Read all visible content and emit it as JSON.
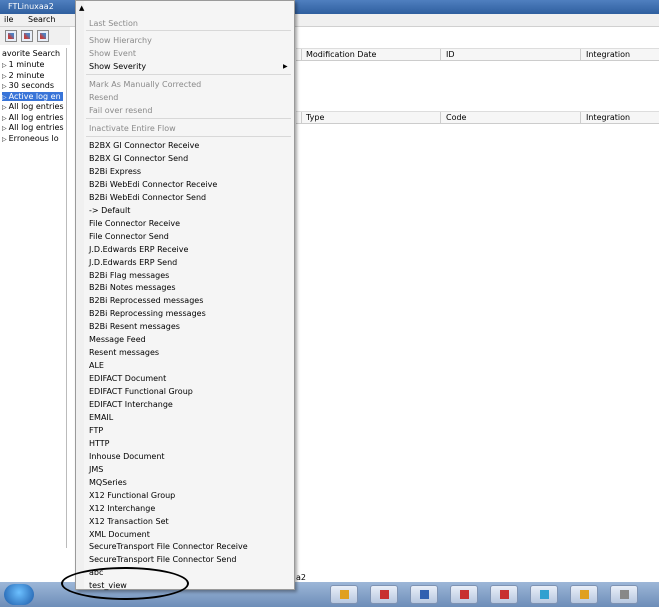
{
  "app": {
    "window_title": "FTLinuxaa2",
    "menu": [
      "File",
      "Search"
    ],
    "menu_visible": [
      "ile",
      "Search"
    ]
  },
  "sidebar": {
    "header": "avorite Search",
    "items": [
      {
        "label": "1 minute",
        "selected": false
      },
      {
        "label": "2 minute",
        "selected": false
      },
      {
        "label": "30 seconds",
        "selected": false
      },
      {
        "label": "Active log en",
        "selected": true
      },
      {
        "label": "All log entries",
        "selected": false
      },
      {
        "label": "All log entries",
        "selected": false
      },
      {
        "label": "All log entries",
        "selected": false
      },
      {
        "label": "Erroneous lo",
        "selected": false
      }
    ]
  },
  "top_table": {
    "columns": [
      "Modification Date",
      "ID",
      "Integration"
    ]
  },
  "bottom_table": {
    "columns": [
      "Type",
      "Code",
      "Integration"
    ]
  },
  "status_text": "a2",
  "context_menu": {
    "items_top": [
      {
        "label": "Last Section",
        "disabled": true
      },
      {
        "label": "Show Hierarchy",
        "disabled": true
      },
      {
        "label": "Show Event",
        "disabled": true
      },
      {
        "label": "Show Severity",
        "disabled": false,
        "has_submenu": true
      },
      {
        "label": "Mark As Manually Corrected",
        "disabled": true
      },
      {
        "label": "Resend",
        "disabled": true
      },
      {
        "label": "Fail over resend",
        "disabled": true
      },
      {
        "label": "Inactivate Entire Flow",
        "disabled": true
      }
    ],
    "flow_items": [
      "B2BX GI Connector Receive",
      "B2BX GI Connector Send",
      "B2Bi Express",
      "B2Bi WebEdi Connector Receive",
      "B2Bi WebEdi Connector Send",
      "-> Default",
      "File Connector Receive",
      "File Connector Send",
      "J.D.Edwards ERP Receive",
      "J.D.Edwards ERP Send",
      "B2Bi Flag messages",
      "B2Bi Notes messages",
      "B2Bi Reprocessed messages",
      "B2Bi Reprocessing messages",
      "B2Bi Resent messages",
      "Message Feed",
      "Resent messages",
      "ALE",
      "EDIFACT Document",
      "EDIFACT Functional Group",
      "EDIFACT Interchange",
      "EMAIL",
      "FTP",
      "HTTP",
      "Inhouse  Document",
      "JMS",
      "MQSeries",
      "X12 Functional Group",
      "X12 Interchange",
      "X12 Transaction Set",
      "XML  Document",
      "SecureTransport File Connector Receive",
      "SecureTransport File Connector Send",
      "abc",
      "test_view"
    ],
    "highlighted": "test_view"
  },
  "icons": {
    "submenu": "chevron-right-icon",
    "scroll": "scroll-up-icon",
    "start": "windows-start-icon"
  },
  "colors": {
    "selection": "#3874d8",
    "titlebar": "#2f5f9f",
    "disabled_text": "#8a8a8a",
    "taskbar": "#6d8db8"
  }
}
